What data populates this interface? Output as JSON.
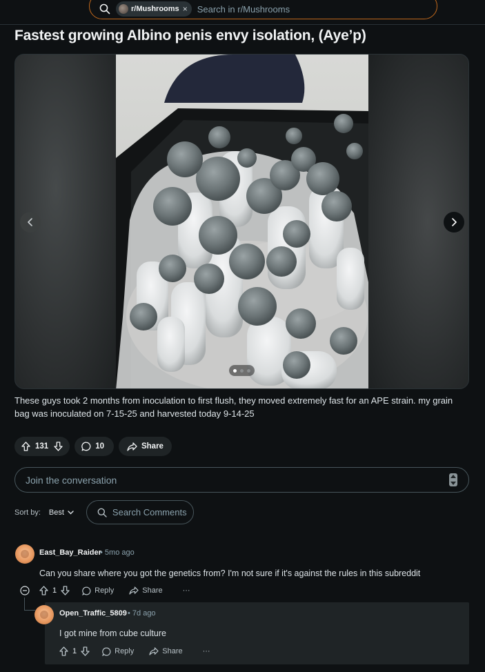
{
  "search": {
    "subreddit_chip": "r/Mushrooms",
    "placeholder": "Search in r/Mushrooms"
  },
  "post": {
    "title": "Fastest growing Albino penis envy isolation, (Aye’p)",
    "body": "These guys took 2 months from inoculation to first flush, they moved extremely fast for an APE strain. my grain bag was inoculated on 7-15-25 and harvested today 9-14-25",
    "gallery": {
      "image_count": 3,
      "active_index": 1
    },
    "upvotes": "131",
    "comments": "10",
    "share_label": "Share"
  },
  "composer": {
    "placeholder": "Join the conversation"
  },
  "sort": {
    "label": "Sort by:",
    "value": "Best",
    "search_placeholder": "Search Comments"
  },
  "comments": [
    {
      "author": "East_Bay_Raider",
      "time": "• 5mo ago",
      "text": "Can you share where you got the genetics from? I'm not sure if it's against the rules in this subreddit",
      "votes": "1",
      "reply_label": "Reply",
      "share_label": "Share",
      "more_label": "···"
    },
    {
      "author": "Open_Traffic_5809",
      "time": "• 7d ago",
      "text": "I got mine from cube culture",
      "votes": "1",
      "reply_label": "Reply",
      "share_label": "Share",
      "more_label": "···"
    }
  ],
  "colors": {
    "background": "#0e1113",
    "search_border": "#c46a1c",
    "pill": "#1f2426",
    "avatar": "#e89a62"
  }
}
